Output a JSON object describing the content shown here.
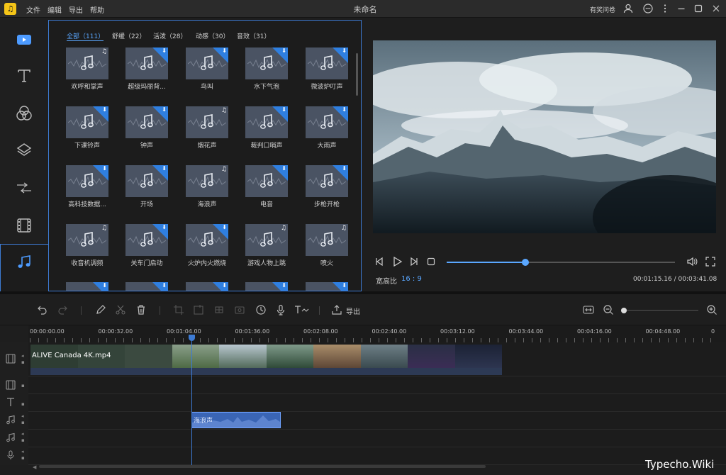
{
  "app": {
    "logo_glyph": "♫",
    "menu": [
      "文件",
      "编辑",
      "导出",
      "帮助"
    ],
    "title": "未命名",
    "feedback": "有奖问卷"
  },
  "sidebar": {
    "items": [
      {
        "icon": "media-icon",
        "active": false
      },
      {
        "icon": "text-icon",
        "active": false
      },
      {
        "icon": "filter-icon",
        "active": false
      },
      {
        "icon": "overlay-icon",
        "active": false
      },
      {
        "icon": "transition-icon",
        "active": false
      },
      {
        "icon": "film-icon",
        "active": false
      },
      {
        "icon": "music-icon",
        "active": true
      }
    ]
  },
  "library": {
    "tabs": [
      {
        "label": "全部（111）",
        "active": true
      },
      {
        "label": "舒缓（22）",
        "active": false
      },
      {
        "label": "活泼（28）",
        "active": false
      },
      {
        "label": "动感（30）",
        "active": false
      },
      {
        "label": "音效（31）",
        "active": false
      }
    ],
    "items": [
      {
        "label": "欢呼和掌声",
        "status": "downloaded"
      },
      {
        "label": "超级玛丽背...",
        "status": "download"
      },
      {
        "label": "鸟叫",
        "status": "download"
      },
      {
        "label": "水下气泡",
        "status": "download"
      },
      {
        "label": "微波炉叮声",
        "status": "download"
      },
      {
        "label": "下课铃声",
        "status": "download"
      },
      {
        "label": "钟声",
        "status": "download"
      },
      {
        "label": "烟花声",
        "status": "downloaded"
      },
      {
        "label": "裁判口哨声",
        "status": "download"
      },
      {
        "label": "大雨声",
        "status": "download"
      },
      {
        "label": "高科技数据...",
        "status": "download"
      },
      {
        "label": "开场",
        "status": "download"
      },
      {
        "label": "海浪声",
        "status": "downloaded"
      },
      {
        "label": "电音",
        "status": "download"
      },
      {
        "label": "步枪开枪",
        "status": "download"
      },
      {
        "label": "收音机调频",
        "status": "downloaded"
      },
      {
        "label": "关车门启动",
        "status": "download"
      },
      {
        "label": "火炉内火燃烧",
        "status": "download"
      },
      {
        "label": "游戏人物上跳",
        "status": "downloaded"
      },
      {
        "label": "喷火",
        "status": "downloaded"
      }
    ]
  },
  "preview": {
    "aspect_label": "宽高比",
    "aspect_value": "16 : 9",
    "time": "00:01:15.16 / 00:03:41.08",
    "progress": 0.34
  },
  "toolbar": {
    "export_label": "导出",
    "zoom_level": 0.0
  },
  "timeline": {
    "ticks": [
      "00:00:00.00",
      "00:00:32.00",
      "00:01:04.00",
      "00:01:36.00",
      "00:02:08.00",
      "00:02:40.00",
      "00:03:12.00",
      "00:03:44.00",
      "00:04:16.00",
      "00:04:48.00",
      "0"
    ],
    "video_clip": "ALIVE  Canada 4K.mp4",
    "audio_clip": "海浪声"
  },
  "watermark": "Typecho.Wiki",
  "colors": {
    "accent": "#3d7bd4",
    "highlight": "#5aa7ff",
    "card": "#4a5363"
  }
}
